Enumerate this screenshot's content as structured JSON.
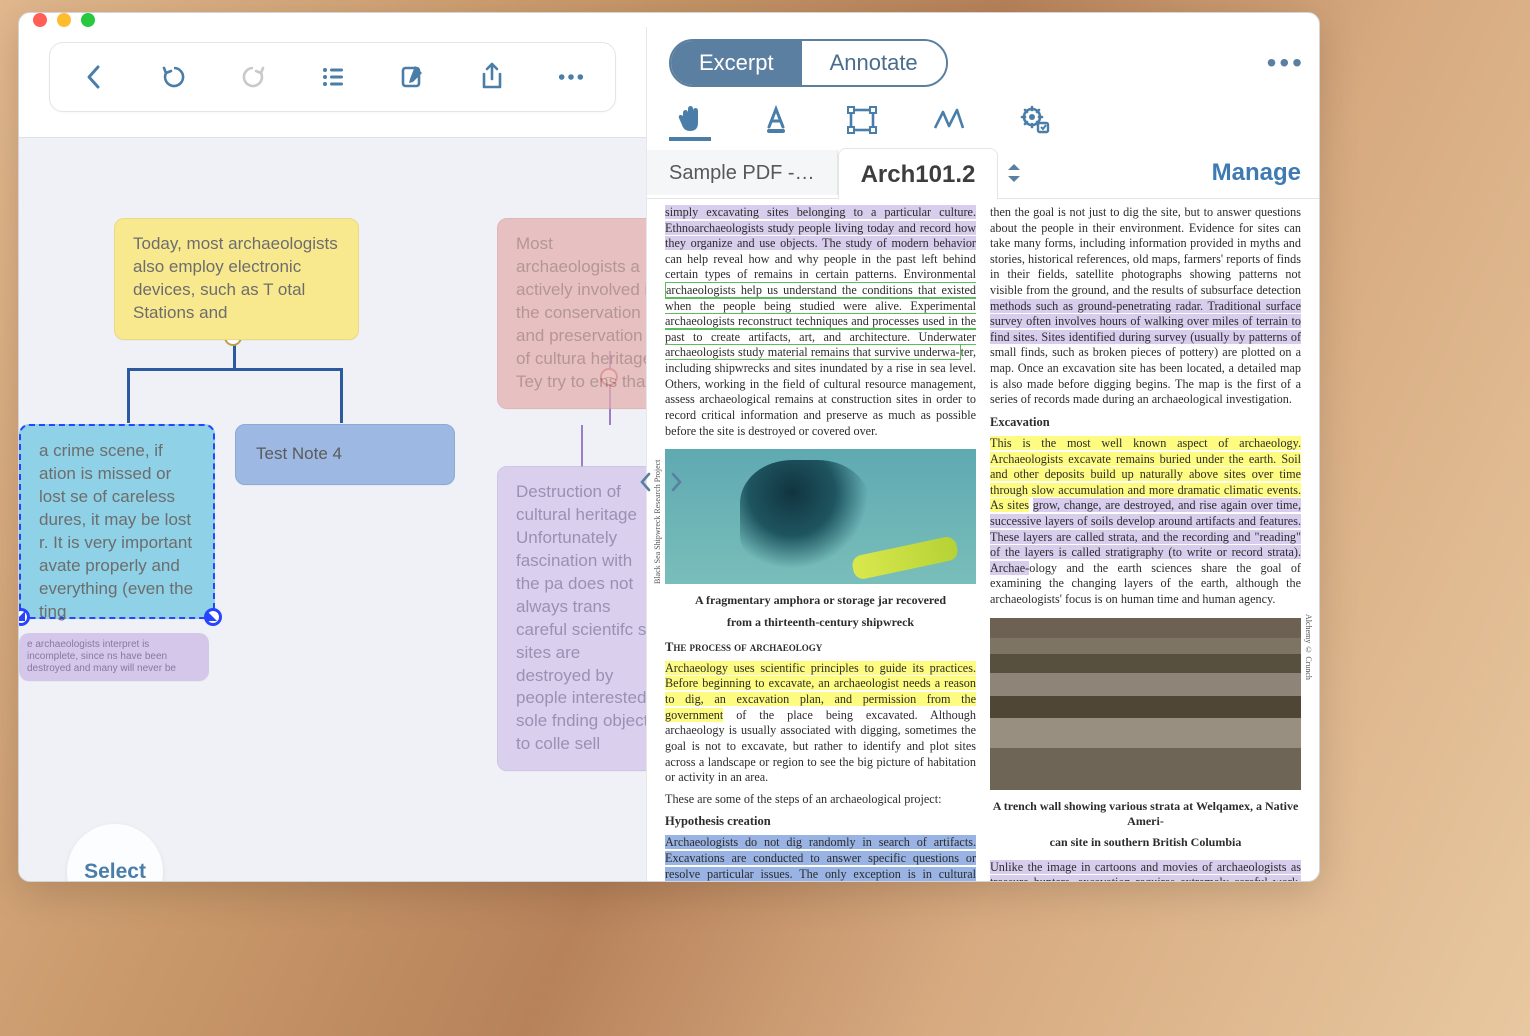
{
  "traffic": {
    "close": "",
    "min": "",
    "max": ""
  },
  "left": {
    "toolbar": {
      "back": "Back",
      "undo": "Undo",
      "redo": "Redo",
      "outline": "Outline",
      "edit": "Edit",
      "share": "Share",
      "more": "More"
    },
    "nodes": {
      "yellow": "Today, most archaeologists also employ electronic devices, such as T otal Stations and",
      "selected": "a crime scene, if ation is missed or lost se of careless dures, it may be lost r. It is very important avate properly and everything (even the ting",
      "test4": "Test Note 4",
      "tiny": "e archaeologists interpret is incomplete, since ns have been destroyed and many will never be",
      "red": "Most archaeologists a actively involved in the conservation and preservation of cultura heritage. Tey try to ens that",
      "lavender": "Destruction of cultural heritage Unfortunately fascination with the pa does not always trans careful scientifc s sites are destroyed by people interested sole fnding objects to colle sell"
    },
    "select_btn": "Select"
  },
  "right": {
    "seg": {
      "excerpt": "Excerpt",
      "annotate": "Annotate"
    },
    "tools": {
      "hand": "Hand",
      "highlight": "Highlight",
      "rect": "Rect",
      "pen": "Pen",
      "settings": "Settings"
    },
    "tabs": {
      "sample": "Sample PDF -…",
      "active": "Arch101.2"
    },
    "manage": "Manage",
    "pdf": {
      "col1": {
        "p_top": "simply excavating sites belonging to a particular culture. Ethnoarchaeologists study people living today and record how they organize and use objects. The study of modern behavior",
        "plain1": "can help reveal how and why people in the past left behind certain types of remains in certain patterns. Environmental",
        "green": "archaeologists help us understand the conditions that existed when the people being studied were alive. Experimental archaeologists reconstruct techniques and processes used in the past to create artifacts, art, and architecture. Underwater archaeologists study material remains that survive underwa-",
        "plain2": "ter, including shipwrecks and sites inundated by a rise in sea level. Others, working in the field of cultural resource management, assess archaeological remains at construction sites in order to record critical information and preserve as much as possible before the site is destroyed or covered over.",
        "cap1a": "A fragmentary amphora or storage jar recovered",
        "cap1b": "from a thirteenth-century shipwreck",
        "sect": "The process of archaeology",
        "yellow1": "Archaeology uses scientific principles to guide its practices. Before beginning to excavate, an archaeologist needs a reason to dig, an excavation plan, and permission from the government",
        "plain3": "of the place being excavated. Although archaeology is usually associated with digging, sometimes the goal is not to excavate, but rather to identify and plot sites across a landscape or region to see the big picture of habitation or activity in an area.",
        "plain4": "These are some of the steps of an archaeological project:",
        "sub1": "Hypothesis creation",
        "blue1": "Archaeologists do not dig randomly in search of artifacts. Excavations are conducted to answer specific questions or resolve particular issues. The only exception is in cultural resource management, undertaken when sites are in danger of being destroyed.",
        "vcap1": "Black Sea Shipwreck Research Project"
      },
      "col2": {
        "plain1": "then the goal is not just to dig the site, but to answer questions about the people in their environment. Evidence for sites can take many forms, including information provided in myths and stories, historical references, old maps, farmers' reports of finds in their fields, satellite photographs showing patterns not visible from the ground, and the results of subsurface detection",
        "p1": "methods such as ground-penetrating radar. Traditional surface survey often involves hours of walking over miles of terrain to find sites. Sites identified during survey (usually by patterns of",
        "plain2": "small finds, such as broken pieces of pottery) are plotted on a map. Once an excavation site has been located, a detailed map is also made before digging begins. The map is the first of a series of records made during an archaeological investigation.",
        "sub1": "Excavation",
        "y1": "This is the most well known aspect of archaeology. Archaeologists excavate remains buried under the earth. Soil and other deposits build up naturally above sites over time through slow accumulation and more dramatic climatic events. As sites",
        "p2": "grow, change, are destroyed, and rise again over time, successive layers of soils develop around artifacts and features. These layers are called strata, and the recording and \"reading\" of the layers is called stratigraphy (to write or record strata). Archae-",
        "plain3": "ology and the earth sciences share the goal of examining the changing layers of the earth, although the archaeologists' focus is on human time and human agency.",
        "cap2a": "A trench wall showing various strata at Welqamex, a Native Ameri-",
        "cap2b": "can site in southern British Columbia",
        "p3": "Unlike the image in cartoons and movies of archaeologists as treasure hunters, excavation requires extremely careful work. Like detectives at a crime scene, archaeologists evaluate and record an archaeological site with great precision in order to preserve the context of artifacts and features, and they work in",
        "vcap2": "Alchemy © Crunch"
      }
    }
  }
}
